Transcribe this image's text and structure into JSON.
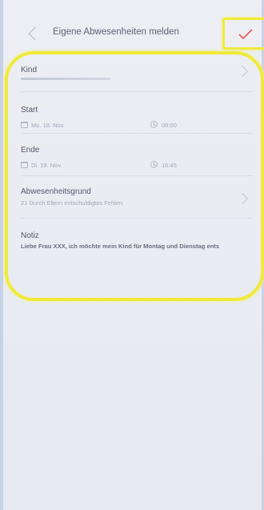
{
  "header": {
    "title": "Eigene Abwesenheiten melden",
    "back_icon": "chevron-left-icon",
    "confirm_icon": "checkmark-icon",
    "confirm_color": "#e8534d"
  },
  "form": {
    "kind": {
      "label": "Kind"
    },
    "start": {
      "label": "Start",
      "date": "Mo. 18. Nov.",
      "time": "08:00"
    },
    "ende": {
      "label": "Ende",
      "date": "Di. 19. Nov.",
      "time": "16:45"
    },
    "grund": {
      "label": "Abwesenheitsgrund",
      "value": "21 Durch Eltern entschuldigtes Fehlen"
    },
    "notiz": {
      "label": "Notiz",
      "value": "Liebe Frau XXX, ich möchte mein Kind für Montag und Dienstag ents"
    }
  },
  "annotation_color": "#f0ea3a"
}
